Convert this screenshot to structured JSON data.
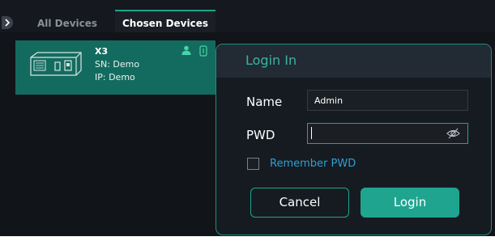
{
  "tabs": {
    "all_devices": "All Devices",
    "chosen_devices": "Chosen Devices"
  },
  "device": {
    "name": "X3",
    "sn": "SN: Demo",
    "ip": "IP: Demo",
    "icons": [
      "device-thumbnail-icon",
      "user-icon",
      "link-icon"
    ]
  },
  "login_dialog": {
    "title": "Login In",
    "name_label": "Name",
    "name_value": "Admin",
    "pwd_label": "PWD",
    "pwd_value": "",
    "remember_label": "Remember PWD",
    "remember_checked": false,
    "cancel_label": "Cancel",
    "login_label": "Login"
  },
  "colors": {
    "accent": "#1fa58f",
    "device_card": "#136b5f",
    "link_blue": "#2f9fd1",
    "background": "#111419"
  }
}
